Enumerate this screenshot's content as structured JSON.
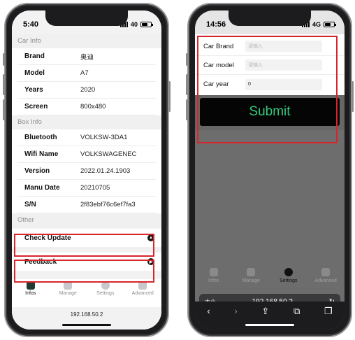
{
  "left_phone": {
    "status_time": "5:40",
    "status_signal": "40",
    "sections": {
      "car_info": "Car Info",
      "box_info": "Box Info",
      "other": "Other"
    },
    "car_info": [
      {
        "label": "Brand",
        "value": "奥迪"
      },
      {
        "label": "Model",
        "value": "A7"
      },
      {
        "label": "Years",
        "value": "2020"
      },
      {
        "label": "Screen",
        "value": "800x480"
      }
    ],
    "box_info": [
      {
        "label": "Bluetooth",
        "value": "VOLKSW-3DA1"
      },
      {
        "label": "Wifi Name",
        "value": "VOLKSWAGENEC"
      },
      {
        "label": "Version",
        "value": "2022.01.24.1903"
      },
      {
        "label": "Manu Date",
        "value": "20210705"
      },
      {
        "label": "S/N",
        "value": "2f83ebf76c6ef7fa3"
      }
    ],
    "other": {
      "check_update": "Check Update",
      "feedback": "Feedback"
    },
    "tabs": [
      {
        "label": "Infos",
        "active": true
      },
      {
        "label": "Manage",
        "active": false
      },
      {
        "label": "Settings",
        "active": false
      },
      {
        "label": "Advanced",
        "active": false
      }
    ],
    "url": "192.168.50.2"
  },
  "right_phone": {
    "status_time": "14:56",
    "status_signal": "4G",
    "form": {
      "brand_label": "Car Brand",
      "brand_placeholder": "请输入",
      "model_label": "Car model",
      "model_placeholder": "请输入",
      "year_label": "Car year",
      "year_value": "0"
    },
    "submit_label": "Submit",
    "tabs": [
      {
        "label": "Infos",
        "active": false
      },
      {
        "label": "Manage",
        "active": false
      },
      {
        "label": "Settings",
        "active": true
      },
      {
        "label": "Advanced",
        "active": false
      }
    ],
    "safari": {
      "aa": "大小",
      "url": "192.168.50.2",
      "reload": "↻",
      "back": "‹",
      "forward": "›",
      "share": "⇪",
      "bookmarks": "⧉",
      "tabs": "❐"
    }
  },
  "colors": {
    "highlight": "#d8252b",
    "submit_text": "#34c77b",
    "active_tab": "#1f3b32"
  }
}
